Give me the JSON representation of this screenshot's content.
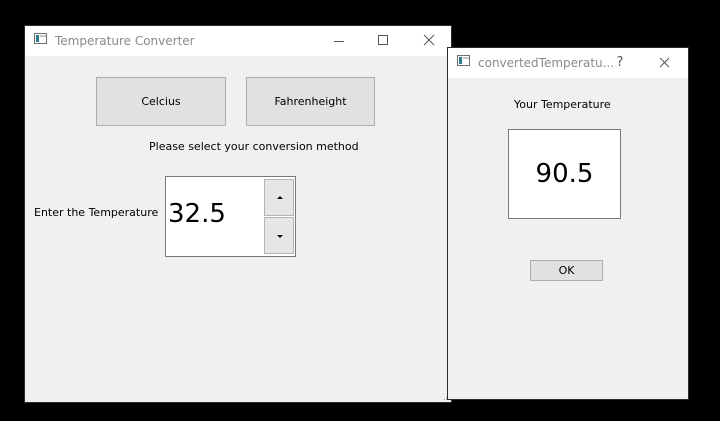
{
  "main_window": {
    "title": "Temperature Converter",
    "celcius_label": "Celcius",
    "fahrenheit_label": "Fahrenheight",
    "instruction": "Please select your conversion method",
    "enter_label": "Enter the Temperature",
    "input_value": "32.5"
  },
  "dialog": {
    "title": "convertedTemperatu...",
    "help_glyph": "?",
    "heading": "Your Temperature",
    "result_value": "90.5",
    "ok_label": "OK"
  },
  "icons": [
    "app-icon",
    "minimize-icon",
    "maximize-icon",
    "close-icon",
    "help-icon",
    "spin-up-icon",
    "spin-down-icon",
    "size-grip-icon"
  ],
  "colors": {
    "window_background": "#f0f0f0",
    "titlebar_background": "#ffffff",
    "button_face": "#e1e1e1",
    "desktop": "#000000"
  }
}
